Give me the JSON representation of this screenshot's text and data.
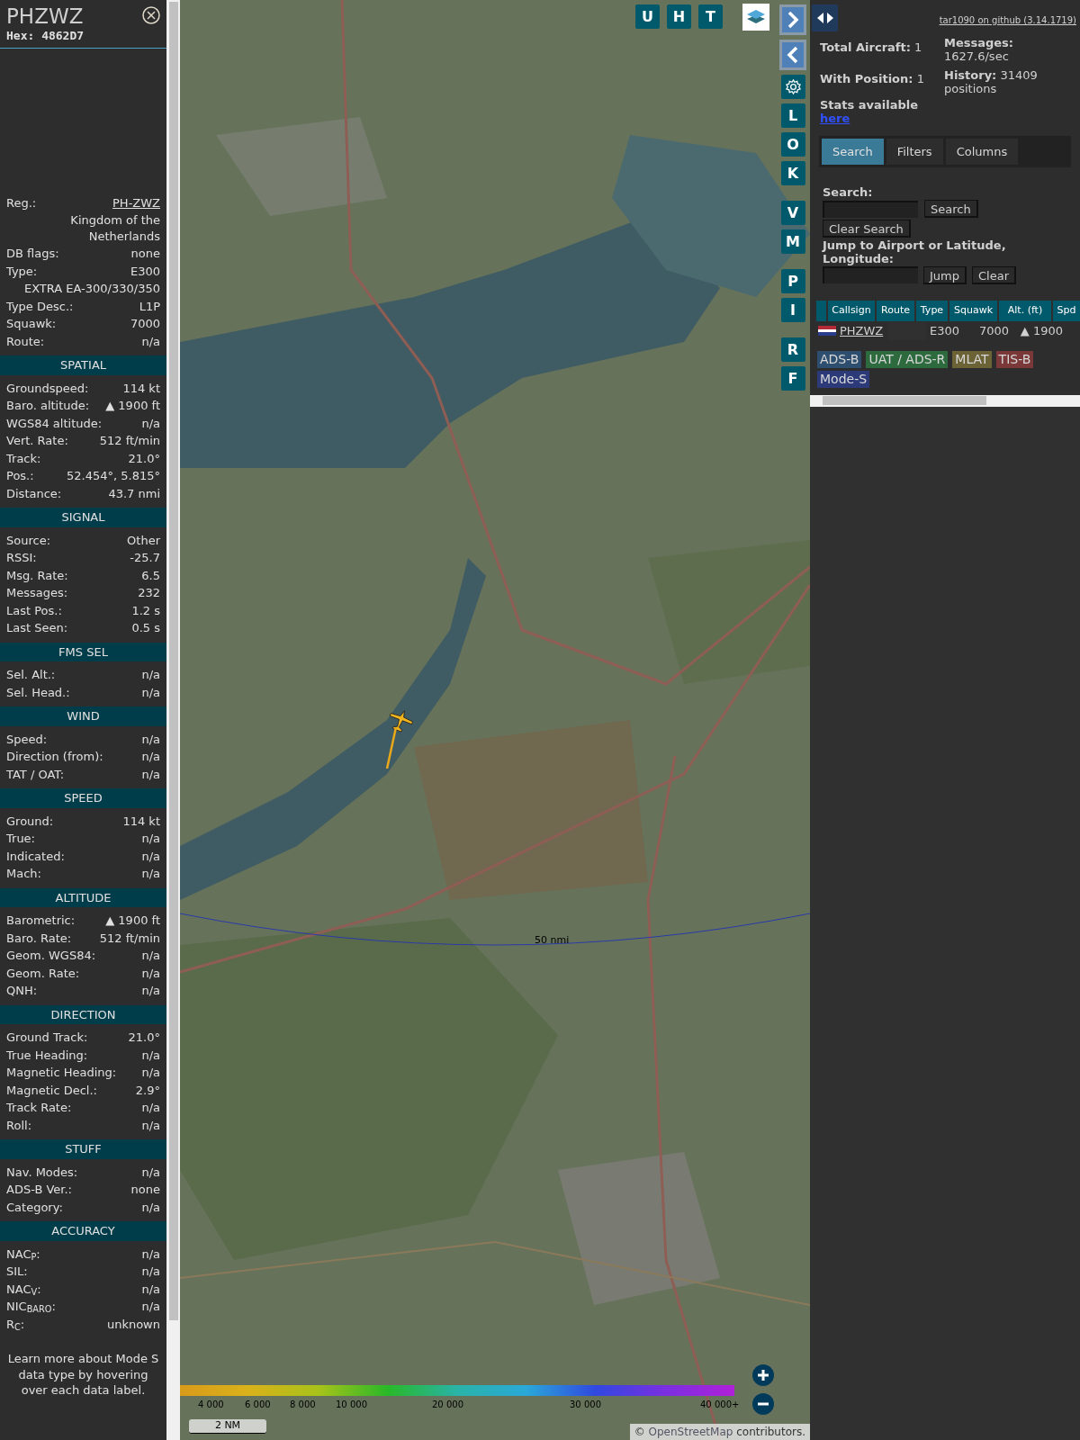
{
  "sidebar": {
    "title": "PHZWZ",
    "hex": "Hex: 4862D7",
    "sections": [
      {
        "rows": [
          {
            "kind": "pair",
            "label": "Reg.:",
            "value": "PH-ZWZ",
            "link": true
          },
          {
            "kind": "value",
            "value": "Kingdom of the Netherlands"
          },
          {
            "kind": "pair",
            "label": "DB flags:",
            "value": "none"
          },
          {
            "kind": "pair",
            "label": "Type:",
            "value": "E300"
          },
          {
            "kind": "value",
            "value": "EXTRA EA-300/330/350"
          },
          {
            "kind": "pair",
            "label": "Type Desc.:",
            "value": "L1P"
          },
          {
            "kind": "pair",
            "label": "Squawk:",
            "value": "7000"
          },
          {
            "kind": "pair",
            "label": "Route:",
            "value": "n/a"
          }
        ]
      },
      {
        "header": "SPATIAL",
        "rows": [
          {
            "kind": "pair",
            "label": "Groundspeed:",
            "value": "114 kt"
          },
          {
            "kind": "pair",
            "label": "Baro. altitude:",
            "value": "▲ 1900 ft"
          },
          {
            "kind": "pair",
            "label": "WGS84 altitude:",
            "value": "n/a"
          },
          {
            "kind": "pair",
            "label": "Vert. Rate:",
            "value": "512 ft/min"
          },
          {
            "kind": "pair",
            "label": "Track:",
            "value": "21.0°"
          },
          {
            "kind": "pair",
            "label": "Pos.:",
            "value": "52.454°, 5.815°"
          },
          {
            "kind": "pair",
            "label": "Distance:",
            "value": "43.7 nmi"
          }
        ]
      },
      {
        "header": "SIGNAL",
        "rows": [
          {
            "kind": "pair",
            "label": "Source:",
            "value": "Other"
          },
          {
            "kind": "pair",
            "label": "RSSI:",
            "value": "-25.7"
          },
          {
            "kind": "pair",
            "label": "Msg. Rate:",
            "value": "6.5"
          },
          {
            "kind": "pair",
            "label": "Messages:",
            "value": "232"
          },
          {
            "kind": "pair",
            "label": "Last Pos.:",
            "value": "1.2 s"
          },
          {
            "kind": "pair",
            "label": "Last Seen:",
            "value": "0.5 s"
          }
        ]
      },
      {
        "header": "FMS SEL",
        "rows": [
          {
            "kind": "pair",
            "label": "Sel. Alt.:",
            "value": "n/a"
          },
          {
            "kind": "pair",
            "label": "Sel. Head.:",
            "value": "n/a"
          }
        ]
      },
      {
        "header": "WIND",
        "rows": [
          {
            "kind": "pair",
            "label": "Speed:",
            "value": "n/a"
          },
          {
            "kind": "pair",
            "label": "Direction (from):",
            "value": "n/a"
          },
          {
            "kind": "pair",
            "label": "TAT / OAT:",
            "value": "n/a"
          }
        ]
      },
      {
        "header": "SPEED",
        "rows": [
          {
            "kind": "pair",
            "label": "Ground:",
            "value": "114 kt"
          },
          {
            "kind": "pair",
            "label": "True:",
            "value": "n/a"
          },
          {
            "kind": "pair",
            "label": "Indicated:",
            "value": "n/a"
          },
          {
            "kind": "pair",
            "label": "Mach:",
            "value": "n/a"
          }
        ]
      },
      {
        "header": "ALTITUDE",
        "rows": [
          {
            "kind": "pair",
            "label": "Barometric:",
            "value": "▲ 1900 ft"
          },
          {
            "kind": "pair",
            "label": "Baro. Rate:",
            "value": "512 ft/min"
          },
          {
            "kind": "pair",
            "label": "Geom. WGS84:",
            "value": "n/a"
          },
          {
            "kind": "pair",
            "label": "Geom. Rate:",
            "value": "n/a"
          },
          {
            "kind": "pair",
            "label": "QNH:",
            "value": "n/a"
          }
        ]
      },
      {
        "header": "DIRECTION",
        "rows": [
          {
            "kind": "pair",
            "label": "Ground Track:",
            "value": "21.0°"
          },
          {
            "kind": "pair",
            "label": "True Heading:",
            "value": "n/a"
          },
          {
            "kind": "pair",
            "label": "Magnetic Heading:",
            "value": "n/a"
          },
          {
            "kind": "pair",
            "label": "Magnetic Decl.:",
            "value": "2.9°"
          },
          {
            "kind": "pair",
            "label": "Track Rate:",
            "value": "n/a"
          },
          {
            "kind": "pair",
            "label": "Roll:",
            "value": "n/a"
          }
        ]
      },
      {
        "header": "STUFF",
        "rows": [
          {
            "kind": "pair",
            "label": "Nav. Modes:",
            "value": "n/a"
          },
          {
            "kind": "pair",
            "label": "ADS-B Ver.:",
            "value": "none"
          },
          {
            "kind": "pair",
            "label": "Category:",
            "value": "n/a"
          }
        ]
      },
      {
        "header": "ACCURACY",
        "rows": [
          {
            "kind": "pair",
            "label": "NAC$_{P}$:",
            "value": "n/a"
          },
          {
            "kind": "pair",
            "label": "SIL:",
            "value": "n/a"
          },
          {
            "kind": "pair",
            "label": "NAC$_{V}$:",
            "value": "n/a"
          },
          {
            "kind": "pair",
            "label": "NIC$_{BARO}$:",
            "value": "n/a"
          },
          {
            "kind": "pair",
            "label": "R$_{C}$:",
            "value": "unknown"
          }
        ]
      }
    ],
    "note": "Learn more about Mode S data type by hovering over each data label."
  },
  "map": {
    "top_buttons": [
      "U",
      "H",
      "T"
    ],
    "side_buttons": [
      {
        "kind": "next"
      },
      {
        "kind": "prev"
      },
      {
        "kind": "settings"
      },
      {
        "kind": "letter",
        "label": "L"
      },
      {
        "kind": "letter",
        "label": "O"
      },
      {
        "kind": "letter",
        "label": "K"
      },
      {
        "kind": "letter",
        "label": "V"
      },
      {
        "kind": "letter",
        "label": "M"
      },
      {
        "kind": "letter",
        "label": "P"
      },
      {
        "kind": "letter",
        "label": "I"
      },
      {
        "kind": "letter",
        "label": "R"
      },
      {
        "kind": "letter",
        "label": "F"
      }
    ],
    "range_label": "50 nmi",
    "legend": [
      "4 000",
      "6 000",
      "8 000",
      "10 000",
      "20 000",
      "30 000",
      "40 000+"
    ],
    "scale": "2 NM",
    "attribution_prefix": "©",
    "attribution_link": "OpenStreetMap",
    "attribution_suffix": "contributors."
  },
  "panel": {
    "github_link": "tar1090 on github (3.14.1719)",
    "stats_left": [
      {
        "label": "Total Aircraft:",
        "value": "1"
      },
      {
        "label": "With Position:",
        "value": "1"
      }
    ],
    "stats_right": [
      {
        "label": "Messages:",
        "value": "1627.6/sec"
      },
      {
        "label": "History:",
        "value": "31409 positions"
      }
    ],
    "stats_link_text": "Stats available",
    "stats_link": "here",
    "tabs": [
      {
        "label": "Search",
        "selected": true
      },
      {
        "label": "Filters",
        "selected": false
      },
      {
        "label": "Columns",
        "selected": false
      }
    ],
    "search_label": "Search:",
    "search_button": "Search",
    "clear_search_button": "Clear Search",
    "jump_label": "Jump to Airport or Latitude, Longitude:",
    "jump_button": "Jump",
    "clear_button": "Clear",
    "table": {
      "columns": [
        "Callsign",
        "Route",
        "Type",
        "Squawk",
        "Alt. (ft)",
        "Spd"
      ],
      "rows": [
        {
          "callsign": "PHZWZ",
          "type": "E300",
          "squawk": "7000",
          "altitude": "▲ 1900"
        }
      ]
    },
    "sources": [
      {
        "label": "ADS-B",
        "color": "#2d4e6e"
      },
      {
        "label": "UAT / ADS-R",
        "color": "#2d6b3f"
      },
      {
        "label": "MLAT",
        "color": "#6b6336"
      },
      {
        "label": "TIS-B",
        "color": "#7a3838"
      },
      {
        "label": "Mode-S",
        "color": "#2c3a7a"
      }
    ]
  }
}
